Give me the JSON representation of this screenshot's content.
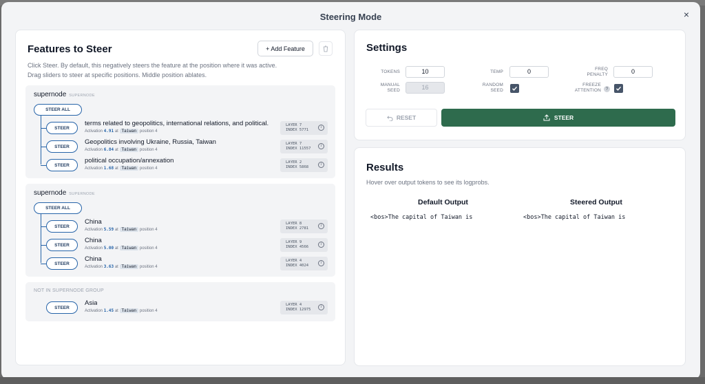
{
  "modal": {
    "title": "Steering Mode",
    "close": "×"
  },
  "left": {
    "title": "Features to Steer",
    "desc_line1": "Click Steer. By default, this negatively steers the feature at the position where it was active.",
    "desc_line2": "Drag sliders to steer at specific positions. Middle position ablates.",
    "add_feature": "+ Add Feature",
    "steer_all": "STEER ALL",
    "steer": "STEER",
    "activation_word": "Activation",
    "at_word": "at",
    "groups": [
      {
        "title": "supernode",
        "tag": "SUPERNODE",
        "features": [
          {
            "name": "terms related to geopolitics, international relations, and political...",
            "activation": "4.91",
            "token": "Taiwan",
            "position": "position 4",
            "layer": "LAYER 7",
            "index": "INDEX 5771"
          },
          {
            "name": "Geopolitics involving Ukraine, Russia, Taiwan",
            "activation": "6.84",
            "token": "Taiwan",
            "position": "position 4",
            "layer": "LAYER 7",
            "index": "INDEX 11557"
          },
          {
            "name": "political occupation/annexation",
            "activation": "1.68",
            "token": "Taiwan",
            "position": "position 4",
            "layer": "LAYER 2",
            "index": "INDEX 5868"
          }
        ]
      },
      {
        "title": "supernode",
        "tag": "SUPERNODE",
        "features": [
          {
            "name": "China",
            "activation": "5.59",
            "token": "Taiwan",
            "position": "position 4",
            "layer": "LAYER 8",
            "index": "INDEX 2781"
          },
          {
            "name": "China",
            "activation": "5.00",
            "token": "Taiwan",
            "position": "position 4",
            "layer": "LAYER 9",
            "index": "INDEX 4566"
          },
          {
            "name": "China",
            "activation": "3.63",
            "token": "Taiwan",
            "position": "position 4",
            "layer": "LAYER 4",
            "index": "INDEX 4024"
          }
        ]
      },
      {
        "note": "NOT IN SUPERNODE GROUP",
        "features": [
          {
            "name": "Asia",
            "activation": "1.45",
            "token": "Taiwan",
            "position": "position 4",
            "layer": "LAYER 4",
            "index": "INDEX 12975"
          }
        ]
      }
    ]
  },
  "settings": {
    "title": "Settings",
    "tokens_label": "TOKENS",
    "tokens_value": "10",
    "temp_label": "TEMP",
    "temp_value": "0",
    "freq_label_1": "FREQ",
    "freq_label_2": "PENALTY",
    "freq_value": "0",
    "seed_label_1": "MANUAL",
    "seed_label_2": "SEED",
    "seed_value": "16",
    "random_label_1": "RANDOM",
    "random_label_2": "SEED",
    "random_checked": true,
    "freeze_label_1": "FREEZE",
    "freeze_label_2": "ATTENTION",
    "freeze_help": "?",
    "freeze_checked": true,
    "reset": "RESET",
    "steer": "STEER"
  },
  "results": {
    "title": "Results",
    "hint": "Hover over output tokens to see its logprobs.",
    "default_header": "Default Output",
    "steered_header": "Steered Output",
    "default_text": "<bos>The capital of Taiwan is",
    "steered_text": "<bos>The capital of Taiwan is"
  },
  "colors": {
    "steer_button": "#2e6b4d",
    "outline_blue": "#2563a8",
    "checkbox": "#475569"
  }
}
